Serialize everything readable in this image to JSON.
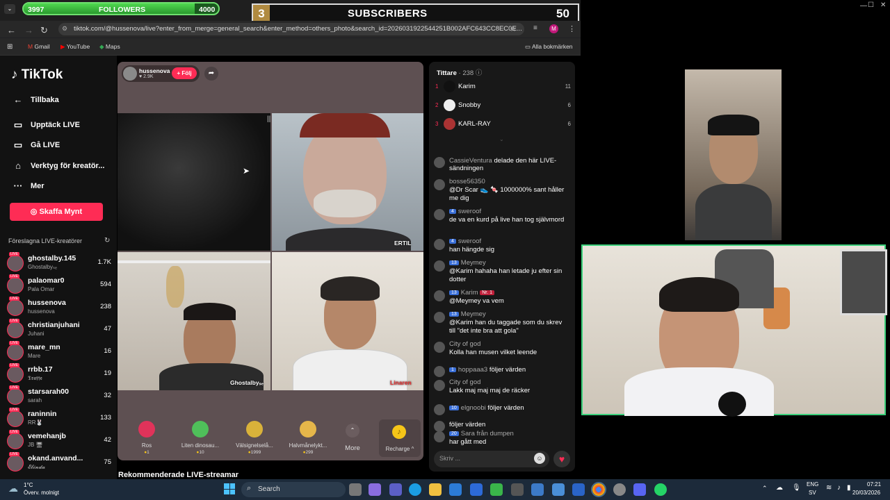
{
  "overlay": {
    "followers_start": "3997",
    "followers_label": "FOLLOWERS",
    "followers_goal": "4000",
    "followers_progress": 0.88,
    "subscribers_count_left": "3",
    "subscribers_label": "SUBSCRIBERS",
    "subscribers_goal": "50"
  },
  "browser": {
    "url": "tiktok.com/@hussenova/live?enter_from_merge=general_search&enter_method=others_photo&search_id=2026031922544251B002AFC643CC8EC0E...",
    "profile_initial": "M",
    "bookmarks": [
      "Gmail",
      "YouTube",
      "Maps"
    ],
    "all_bookmarks": "Alla bokmärken"
  },
  "sidebar": {
    "logo": "TikTok",
    "back": "Tillbaka",
    "nav": [
      "Upptäck LIVE",
      "Gå LIVE",
      "Verktyg för kreatör...",
      "Mer"
    ],
    "coins_button": "Skaffa Mynt",
    "suggested_title": "Föreslagna LIVE-kreatörer",
    "live_badge": "LIVE",
    "creators": [
      {
        "name": "ghostalby.145",
        "sub": "Ghostalbyₛₑ",
        "count": "1.7K"
      },
      {
        "name": "palaomar0",
        "sub": "Pala Omar",
        "count": "594"
      },
      {
        "name": "hussenova",
        "sub": "hussenova",
        "count": "238"
      },
      {
        "name": "christianjuhani",
        "sub": "Juhani",
        "count": "47"
      },
      {
        "name": "mare_mn",
        "sub": "Mare",
        "count": "16"
      },
      {
        "name": "rrbb.17",
        "sub": "𝕿𝖗𝖆𝖋𝖋𝖊",
        "count": "19"
      },
      {
        "name": "starsarah00",
        "sub": "sarah",
        "count": "32"
      },
      {
        "name": "raninnin",
        "sub": "RR🐰",
        "count": "133"
      },
      {
        "name": "vemehanjb",
        "sub": "JB 🖥",
        "count": "42"
      },
      {
        "name": "okand.anvand...",
        "sub": "𝓔𝓵𝓲𝓷𝓭𝓪",
        "count": "75"
      }
    ]
  },
  "stream": {
    "host": "hussenova",
    "likes": "♥ 2.9K",
    "follow": "+ Följ",
    "tile_labels": [
      "ERTIL",
      "Ghostalbyₛₑ",
      "Linaren"
    ],
    "gifts": [
      {
        "name": "Ros",
        "price": "1",
        "color": "#e0335a"
      },
      {
        "name": "Liten dinosau...",
        "price": "10",
        "color": "#4fbf5a"
      },
      {
        "name": "Välsignelselå...",
        "price": "1999",
        "color": "#d9b23a"
      },
      {
        "name": "Halvmånelykt...",
        "price": "299",
        "color": "#e5b64a"
      }
    ],
    "more": "More",
    "recharge": "Recharge ^",
    "recommended": "Rekommenderade LIVE-streamar"
  },
  "viewers": {
    "title": "Tittare",
    "count": "· 238",
    "top": [
      {
        "rank": "1",
        "name": "Karim",
        "score": "11"
      },
      {
        "rank": "2",
        "name": "Snobby",
        "score": "6"
      },
      {
        "rank": "3",
        "name": "KARL-RAY",
        "score": "6"
      }
    ]
  },
  "chat": {
    "messages": [
      {
        "user": "CassieVentura",
        "badge": "",
        "text": "delade den här LIVE-sändningen",
        "inline": true
      },
      {
        "user": "bosse56350",
        "badge": "",
        "text": "@Dr Scar 👟 🍬 1000000% sant håller me dig",
        "inline": false
      },
      {
        "user": "sweroof",
        "badge": "4",
        "text": "de va en kurd på live han tog självmord",
        "inline": false
      },
      {
        "user": "sweroof",
        "badge": "4",
        "text": "han hängde sig",
        "inline": false
      },
      {
        "user": "Meymey",
        "badge": "13",
        "text": "@Karim hahaha han letade ju efter sin dotter",
        "inline": false
      },
      {
        "user": "Karim",
        "badge": "13",
        "text": "@Meymey va vem",
        "inline": false,
        "extra": "Nr. 1"
      },
      {
        "user": "Meymey",
        "badge": "13",
        "text": "@Karim han du taggade som du skrev till \"det inte bra att gola\"",
        "inline": false
      },
      {
        "user": "City of god",
        "badge": "",
        "text": "Kolla han musen vilket leende",
        "inline": false
      },
      {
        "user": "hoppaaa3",
        "badge": "1",
        "text": "följer värden",
        "inline": true
      },
      {
        "user": "City of god",
        "badge": "",
        "text": "Lakk maj maj maj de räcker",
        "inline": false
      },
      {
        "user": "elgnoobi",
        "badge": "10",
        "text": "följer värden",
        "inline": true
      },
      {
        "user": "",
        "badge": "",
        "text": "följer värden",
        "inline": true
      },
      {
        "user": "Sara från dumpen",
        "badge": "20",
        "text": "har gått med",
        "inline": false
      }
    ],
    "input_placeholder": "Skriv ..."
  },
  "taskbar": {
    "weather_temp": "1°C",
    "weather_desc": "Överv. molnigt",
    "search": "Search",
    "lang_top": "ENG",
    "lang_bottom": "SV",
    "time": "07:21",
    "date": "20/03/2026"
  }
}
